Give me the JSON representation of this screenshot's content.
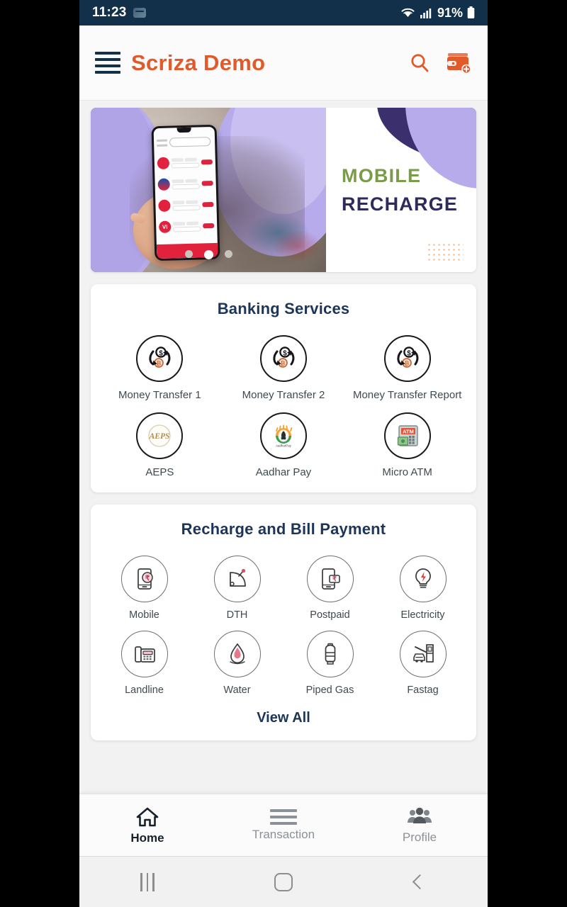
{
  "status_bar": {
    "time": "11:23",
    "battery_percent": "91%",
    "icons": [
      "app-badge-icon",
      "wifi-icon",
      "signal-bars-icon",
      "battery-icon"
    ]
  },
  "header": {
    "menu_icon": "hamburger-menu-icon",
    "title": "Scriza Demo",
    "title_color": "#e2592a",
    "search_icon": "search-icon",
    "wallet_icon": "wallet-add-icon"
  },
  "banner": {
    "line1": "MOBILE",
    "line2": "RECHARGE",
    "line1_color": "#7a9b4a",
    "line2_color": "#2d2a5c",
    "dots": 3,
    "active_dot": 1
  },
  "banking_services": {
    "title": "Banking Services",
    "items": [
      {
        "label": "Money Transfer 1",
        "icon": "money-transfer-icon"
      },
      {
        "label": "Money Transfer 2",
        "icon": "money-transfer-icon"
      },
      {
        "label": "Money Transfer Report",
        "icon": "money-transfer-icon"
      },
      {
        "label": "AEPS",
        "icon": "aeps-icon"
      },
      {
        "label": "Aadhar Pay",
        "icon": "aadhaar-pay-icon"
      },
      {
        "label": "Micro ATM",
        "icon": "micro-atm-icon"
      }
    ]
  },
  "recharge_bill_payment": {
    "title": "Recharge and Bill Payment",
    "items": [
      {
        "label": "Mobile",
        "icon": "mobile-phone-icon"
      },
      {
        "label": "DTH",
        "icon": "satellite-dish-icon"
      },
      {
        "label": "Postpaid",
        "icon": "postpaid-phone-icon"
      },
      {
        "label": "Electricity",
        "icon": "lightbulb-icon"
      },
      {
        "label": "Landline",
        "icon": "landline-phone-icon"
      },
      {
        "label": "Water",
        "icon": "water-drop-icon"
      },
      {
        "label": "Piped Gas",
        "icon": "gas-cylinder-icon"
      },
      {
        "label": "Fastag",
        "icon": "fastag-toll-icon"
      }
    ],
    "view_all": "View All"
  },
  "bottom_nav": {
    "items": [
      {
        "label": "Home",
        "icon": "home-icon",
        "active": true
      },
      {
        "label": "Transaction",
        "icon": "list-lines-icon",
        "active": false
      },
      {
        "label": "Profile",
        "icon": "people-icon",
        "active": false
      }
    ]
  },
  "android_nav": {
    "recent_icon": "recent-apps-icon",
    "home_icon": "home-square-icon",
    "back_icon": "back-chevron-icon"
  }
}
